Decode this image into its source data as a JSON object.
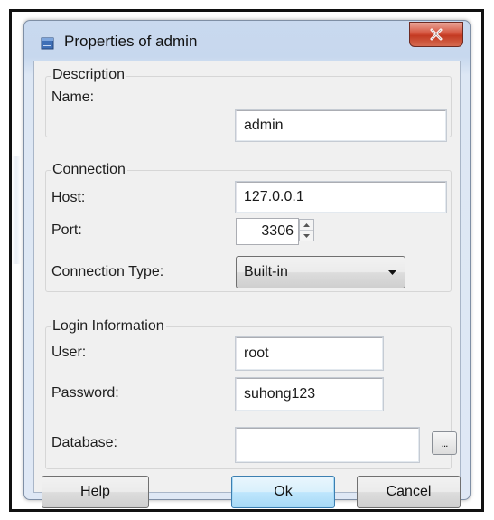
{
  "window": {
    "title": "Properties of admin",
    "close_symbol": "x",
    "icon": "database-properties-icon"
  },
  "description_group": {
    "title": "Description",
    "name_label": "Name:",
    "name_value": "admin"
  },
  "connection_group": {
    "title": "Connection",
    "host_label": "Host:",
    "host_value": "127.0.0.1",
    "port_label": "Port:",
    "port_value": "3306",
    "type_label": "Connection Type:",
    "type_value": "Built-in"
  },
  "login_group": {
    "title": "Login Information",
    "user_label": "User:",
    "user_value": "root",
    "password_label": "Password:",
    "password_value": "suhong123",
    "database_label": "Database:",
    "database_value": "",
    "browse_label": "..."
  },
  "buttons": {
    "help": "Help",
    "ok": "Ok",
    "cancel": "Cancel"
  },
  "colors": {
    "title_bar": "#c9d9ef",
    "close_button": "#c33a22",
    "client_bg": "#f0f0f0"
  }
}
